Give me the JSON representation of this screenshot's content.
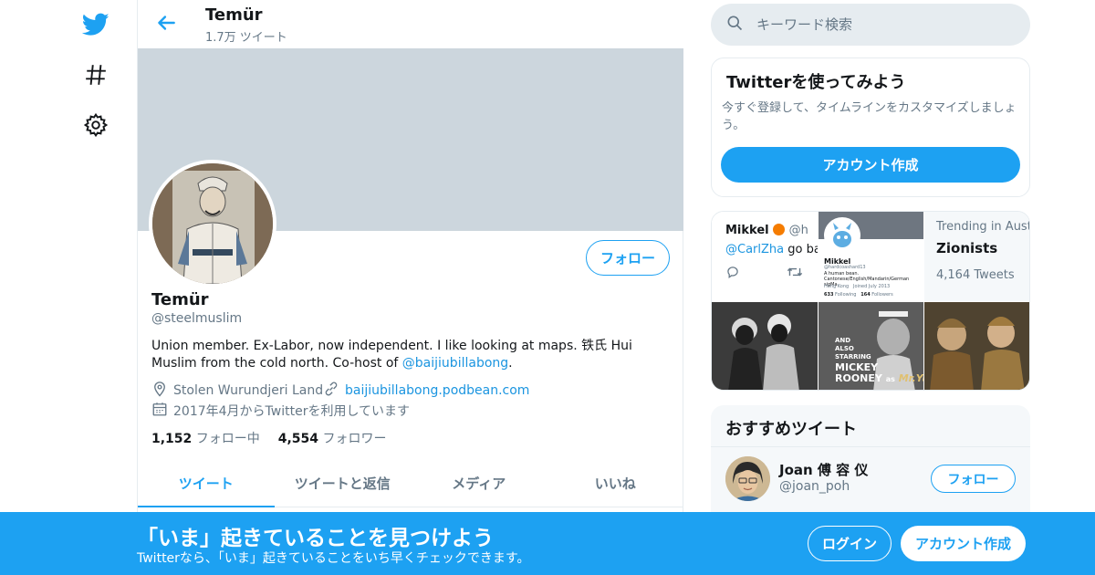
{
  "colors": {
    "accent": "#1da1f2",
    "banner": "#ccd6dd",
    "text_secondary": "#657786",
    "link": "#1b95e0"
  },
  "nav": {
    "items": [
      {
        "icon": "twitter-bird-icon"
      },
      {
        "icon": "hashtag-icon"
      },
      {
        "icon": "gear-icon"
      }
    ]
  },
  "header": {
    "back_icon": "arrow-left-icon",
    "name": "Temür",
    "tweet_count": "1.7万 ツイート"
  },
  "profile": {
    "follow_label": "フォロー",
    "name": "Temür",
    "handle": "@steelmuslim",
    "bio_text": "Union member. Ex-Labor, now independent. I like looking at maps. 铁氏 Hui Muslim from the cold north. Co-host of ",
    "bio_mention": "@baijiubillabong",
    "bio_end": ".",
    "location": "Stolen Wurundjeri Land",
    "website": "baijiubillabong.podbean.com",
    "joined": "2017年4月からTwitterを利用しています",
    "following_count": "1,152",
    "following_label": "フォロー中",
    "followers_count": "4,554",
    "followers_label": "フォロワー"
  },
  "tabs": [
    {
      "label": "ツイート",
      "active": true
    },
    {
      "label": "ツイートと返信",
      "active": false
    },
    {
      "label": "メディア",
      "active": false
    },
    {
      "label": "いいね",
      "active": false
    }
  ],
  "search": {
    "placeholder": "キーワード検索"
  },
  "signup_card": {
    "title": "Twitterを使ってみよう",
    "description": "今すぐ登録して、タイムラインをカスタマイズしましょう。",
    "button": "アカウント作成"
  },
  "media_grid": {
    "tweet_snippet": {
      "name": "Mikkel",
      "handle": "@h",
      "mention": "@CarlZha",
      "text": "go bac"
    },
    "profile_snippet": {
      "name": "Mikkel",
      "handle": "@hardcoashard13",
      "bio": "A human bean. Cantonese/English/Mandarin/German sigMa",
      "joined": "Joined July 2013",
      "following": "633",
      "following_label": "Following",
      "followers": "164",
      "followers_label": "Followers",
      "location": "Hong Kong"
    },
    "trending": {
      "label": "Trending in Aust",
      "topic": "Zionists",
      "count": "4,164 Tweets"
    },
    "poster": {
      "line1": "AND",
      "line2": "ALSO",
      "line3": "STARRING",
      "line4": "MICKEY",
      "line5": "ROONEY",
      "line6": "as",
      "line7": "Mr.Yun"
    }
  },
  "recommended": {
    "title": "おすすめツイート",
    "name": "Joan 傅 容 仪",
    "handle": "@joan_poh",
    "follow_label": "フォロー"
  },
  "bottom_bar": {
    "title": "「いま」起きていることを見つけよう",
    "subtitle": "Twitterなら、「いま」起きていることをいち早くチェックできます。",
    "login": "ログイン",
    "signup": "アカウント作成"
  }
}
